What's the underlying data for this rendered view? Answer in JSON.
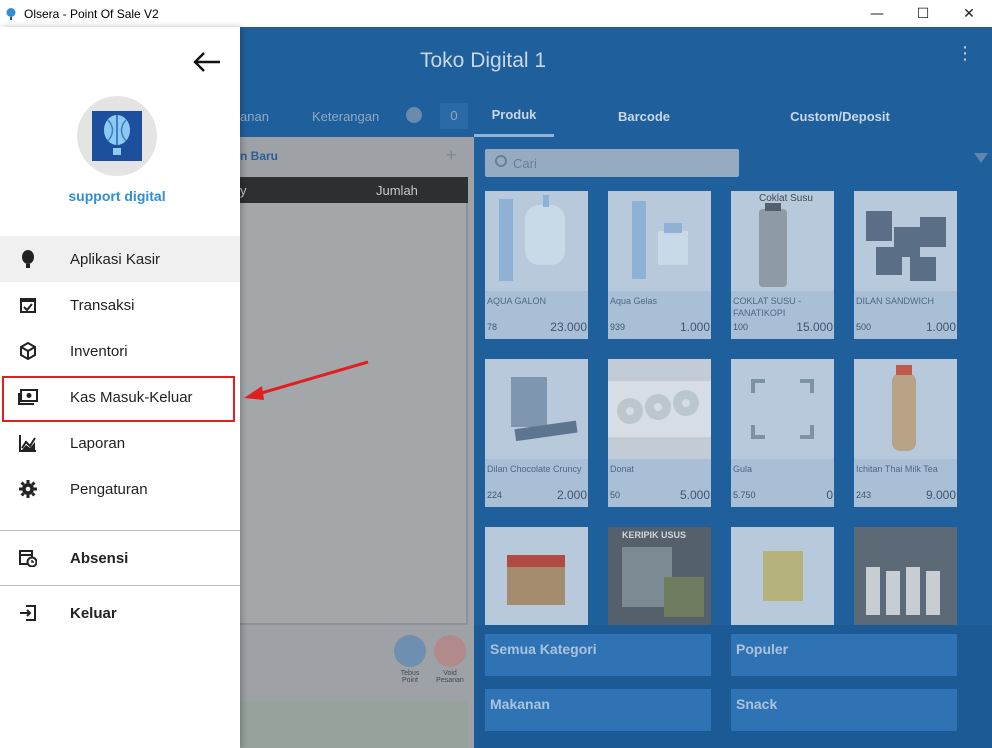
{
  "window": {
    "title": "Olsera - Point Of Sale V2",
    "minimize": "—",
    "maximize": "☐",
    "close": "✕"
  },
  "topbar": {
    "store_name": "Toko Digital 1",
    "menu": "⋮"
  },
  "left_tabs": {
    "tab1": "anan",
    "tab2": "Keterangan",
    "count": "0"
  },
  "product_tabs": [
    {
      "label": "Produk",
      "active": true
    },
    {
      "label": "Barcode",
      "active": false
    },
    {
      "label": "Custom/Deposit",
      "active": false
    }
  ],
  "order": {
    "new_label": "n Baru",
    "plus": "+",
    "col_item": "y",
    "col_qty": "Jumlah",
    "actions": [
      {
        "label_1": "Tebus",
        "label_2": "Point",
        "color": "#6f8fb0"
      },
      {
        "label_1": "Void",
        "label_2": "Pesanan",
        "color": "#b38a8c"
      }
    ]
  },
  "search": {
    "placeholder": "Cari"
  },
  "products": [
    {
      "name": "AQUA GALON",
      "stock": "78",
      "price": "23.000"
    },
    {
      "name": "Aqua Gelas",
      "stock": "939",
      "price": "1.000"
    },
    {
      "name": "COKLAT SUSU - FANATIKOPI",
      "stock": "100",
      "price": "15.000"
    },
    {
      "name": "DILAN SANDWICH",
      "stock": "500",
      "price": "1.000"
    },
    {
      "name": "Dilan Chocolate Cruncy",
      "stock": "224",
      "price": "2.000"
    },
    {
      "name": "Donat",
      "stock": "50",
      "price": "5.000"
    },
    {
      "name": "Gula",
      "stock": "5.750",
      "price": "0"
    },
    {
      "name": "Ichitan Thai Milk Tea",
      "stock": "243",
      "price": "9.000"
    },
    {
      "name": "",
      "stock": "",
      "price": ""
    },
    {
      "name": "",
      "stock": "",
      "price": ""
    },
    {
      "name": "",
      "stock": "",
      "price": ""
    },
    {
      "name": "",
      "stock": "",
      "price": ""
    }
  ],
  "product_image_text": {
    "coklat": "Coklat Susu",
    "keripik": "KERIPIK USUS"
  },
  "categories": [
    "Semua Kategori",
    "Populer",
    "Makanan",
    "Snack"
  ],
  "drawer": {
    "username": "support digital",
    "menu": [
      {
        "label": "Aplikasi Kasir",
        "icon": "balloon-icon"
      },
      {
        "label": "Transaksi",
        "icon": "calendar-check-icon"
      },
      {
        "label": "Inventori",
        "icon": "box-icon"
      },
      {
        "label": "Kas Masuk-Keluar",
        "icon": "cash-icon"
      },
      {
        "label": "Laporan",
        "icon": "chart-icon"
      },
      {
        "label": "Pengaturan",
        "icon": "gear-icon"
      }
    ],
    "absensi": "Absensi",
    "keluar": "Keluar"
  },
  "colors": {
    "primary": "#1f5f9c",
    "accent": "#2f8ed6",
    "highlight": "#e02020"
  }
}
